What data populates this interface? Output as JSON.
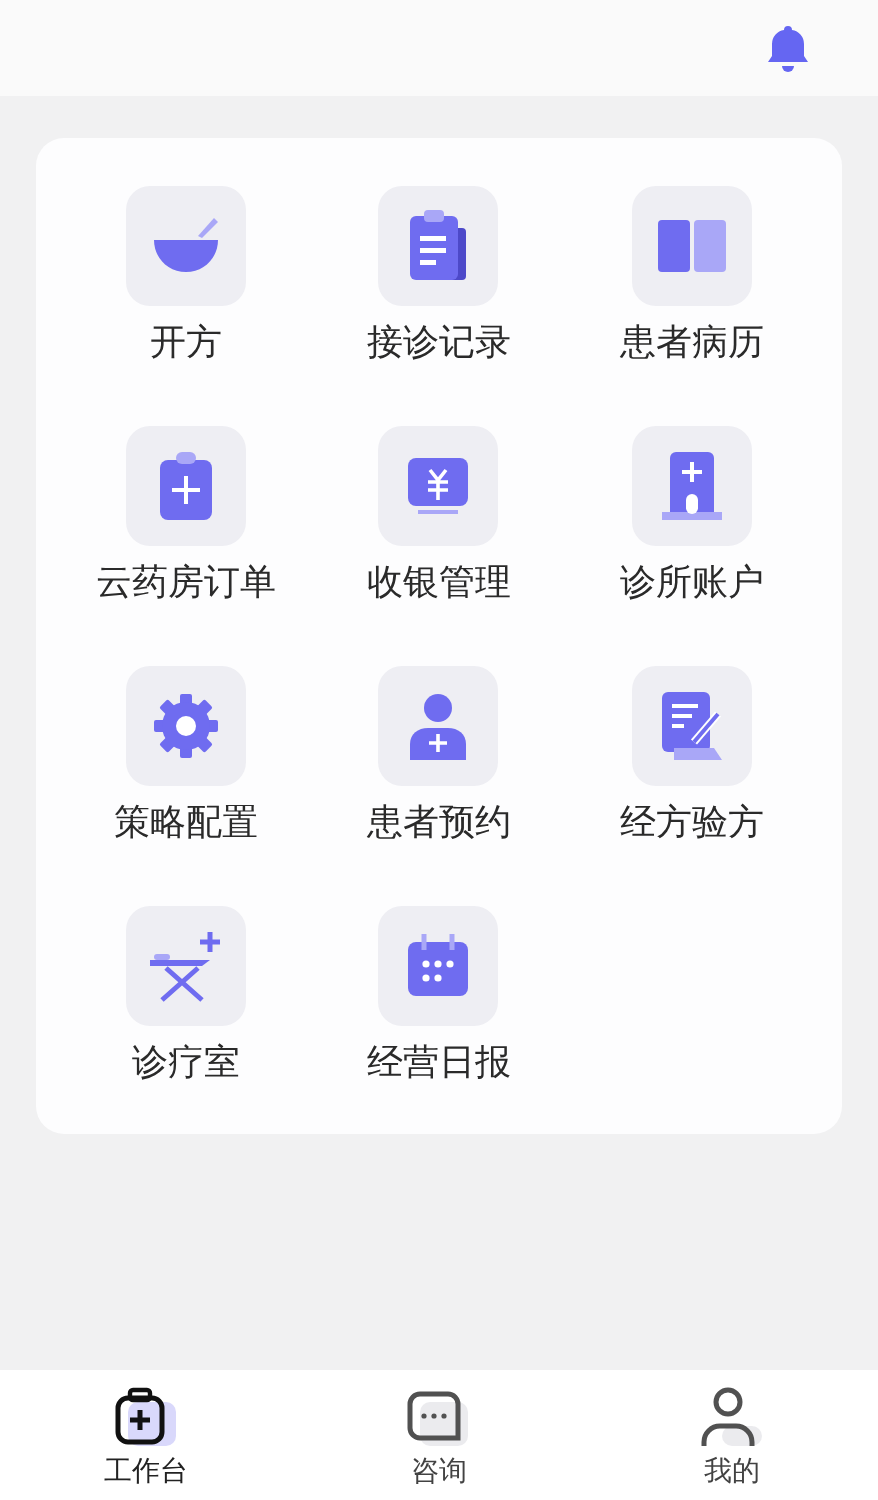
{
  "features": [
    {
      "label": "开方"
    },
    {
      "label": "接诊记录"
    },
    {
      "label": "患者病历"
    },
    {
      "label": "云药房订单"
    },
    {
      "label": "收银管理"
    },
    {
      "label": "诊所账户"
    },
    {
      "label": "策略配置"
    },
    {
      "label": "患者预约"
    },
    {
      "label": "经方验方"
    },
    {
      "label": "诊疗室"
    },
    {
      "label": "经营日报"
    }
  ],
  "tab_bar": [
    {
      "label": "工作台",
      "selected": true
    },
    {
      "label": "咨询",
      "selected": false
    },
    {
      "label": "我的",
      "selected": false
    }
  ]
}
